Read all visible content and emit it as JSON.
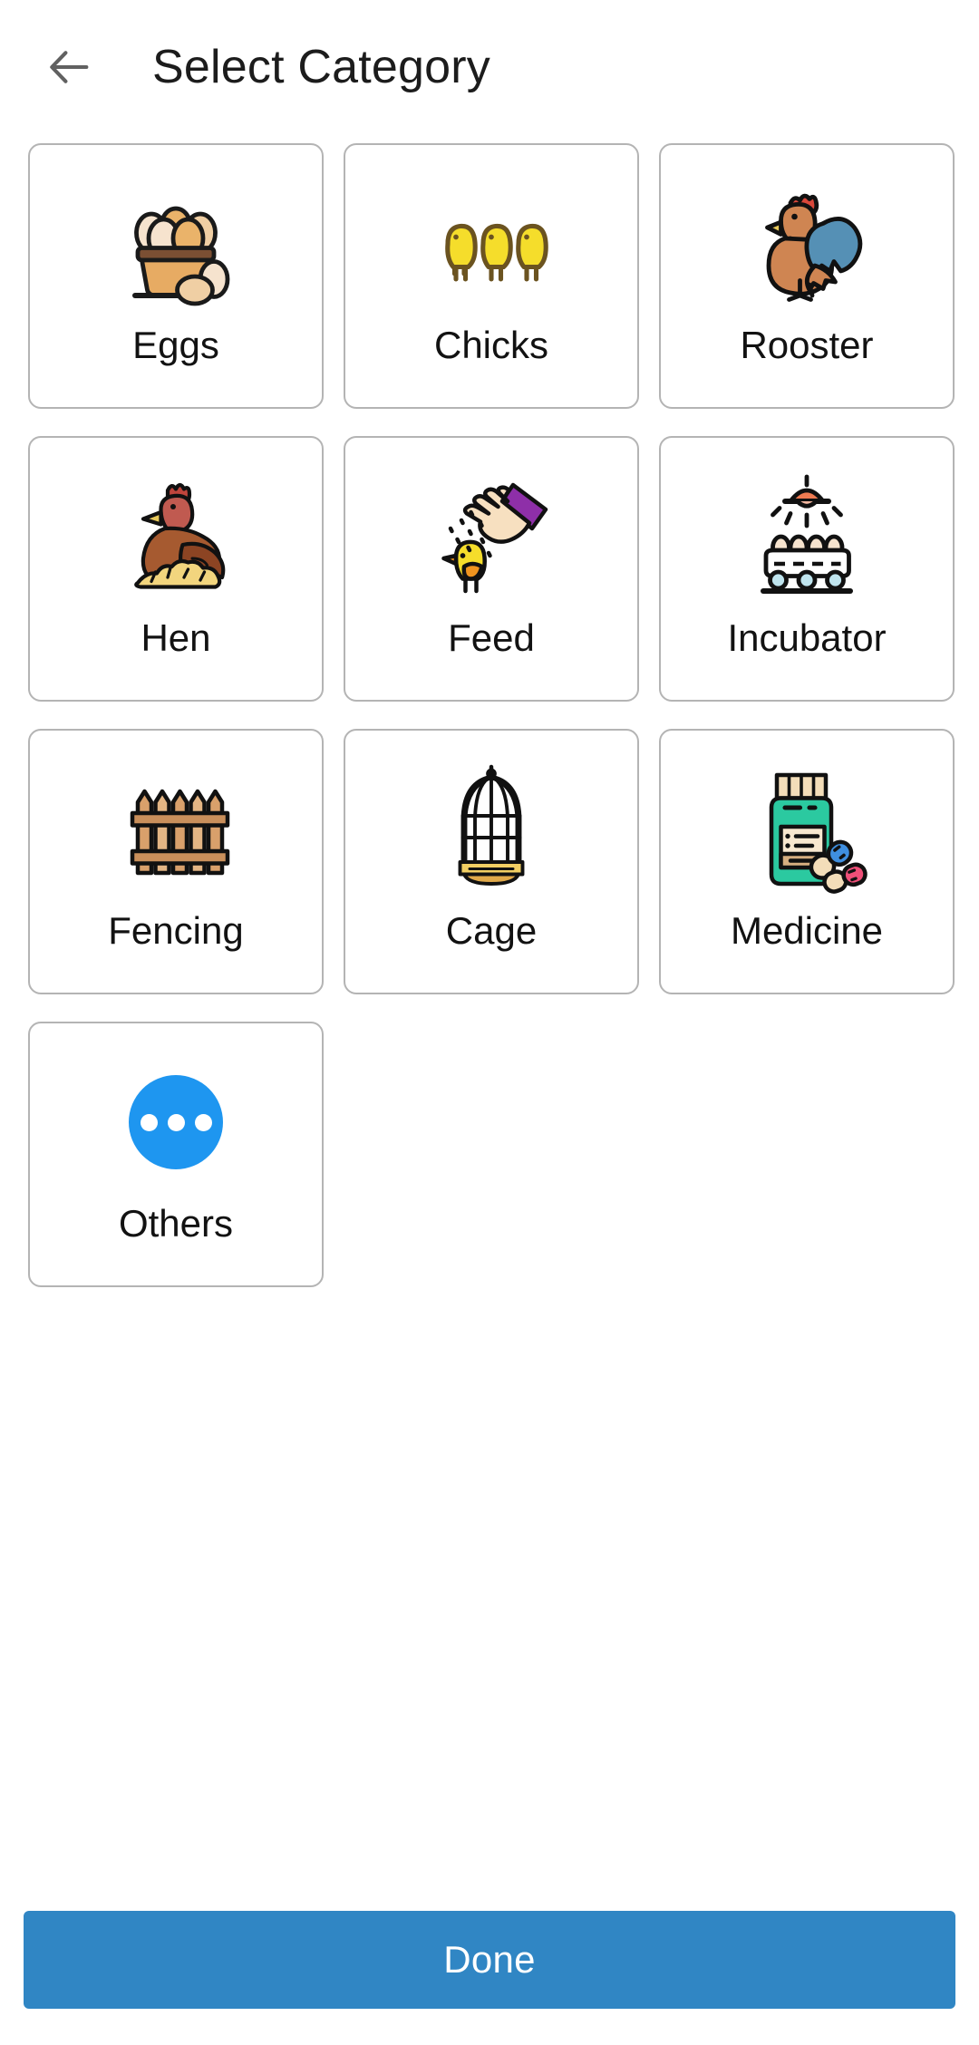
{
  "header": {
    "back_icon": "arrow-left-icon",
    "title": "Select Category"
  },
  "colors": {
    "accent_button": "#3086C4",
    "others_circle": "#1E96F0",
    "card_border": "#b4b4b4",
    "title_text": "#1c1c1c",
    "label_text": "#121212",
    "back_arrow": "#616161",
    "page_background": "#ffffff"
  },
  "grid": {
    "columns": 3,
    "items": [
      {
        "id": "eggs",
        "label": "Eggs",
        "icon": "eggs-basket-icon",
        "selected": false
      },
      {
        "id": "chicks",
        "label": "Chicks",
        "icon": "chicks-icon",
        "selected": false
      },
      {
        "id": "rooster",
        "label": "Rooster",
        "icon": "rooster-icon",
        "selected": false
      },
      {
        "id": "hen",
        "label": "Hen",
        "icon": "hen-icon",
        "selected": false
      },
      {
        "id": "feed",
        "label": "Feed",
        "icon": "feed-hand-icon",
        "selected": false
      },
      {
        "id": "incubator",
        "label": "Incubator",
        "icon": "incubator-icon",
        "selected": false
      },
      {
        "id": "fencing",
        "label": "Fencing",
        "icon": "fence-icon",
        "selected": false
      },
      {
        "id": "cage",
        "label": "Cage",
        "icon": "birdcage-icon",
        "selected": false
      },
      {
        "id": "medicine",
        "label": "Medicine",
        "icon": "medicine-bottle-icon",
        "selected": false
      },
      {
        "id": "others",
        "label": "Others",
        "icon": "ellipsis-circle-icon",
        "selected": false
      }
    ]
  },
  "footer": {
    "done_label": "Done"
  }
}
